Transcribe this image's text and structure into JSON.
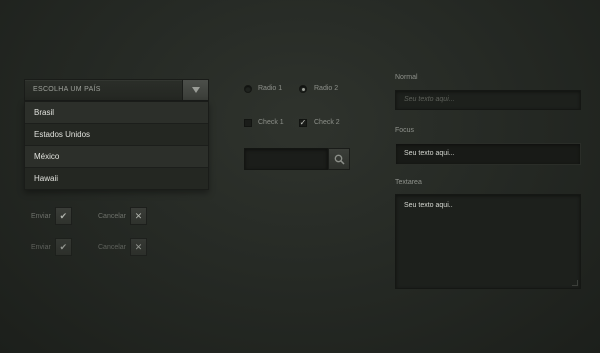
{
  "select": {
    "placeholder": "ESCOLHA UM PAÍS",
    "options": [
      "Brasil",
      "Estados Unidos",
      "México",
      "Hawaii"
    ]
  },
  "buttons": {
    "row1": {
      "send": "Enviar",
      "cancel": "Cancelar"
    },
    "row2": {
      "send": "Enviar",
      "cancel": "Cancelar"
    }
  },
  "radios": [
    {
      "label": "Radio 1",
      "checked": false
    },
    {
      "label": "Radio 2",
      "checked": true
    }
  ],
  "checks": [
    {
      "label": "Check 1",
      "checked": false
    },
    {
      "label": "Check 2",
      "checked": true
    }
  ],
  "search": {
    "value": ""
  },
  "fields": {
    "normal": {
      "label": "Normal",
      "placeholder": "Seu texto aqui..."
    },
    "focus": {
      "label": "Focus",
      "value": "Seu texto aqui..."
    },
    "textarea": {
      "label": "Textarea",
      "value": "Seu texto aqui.."
    }
  }
}
